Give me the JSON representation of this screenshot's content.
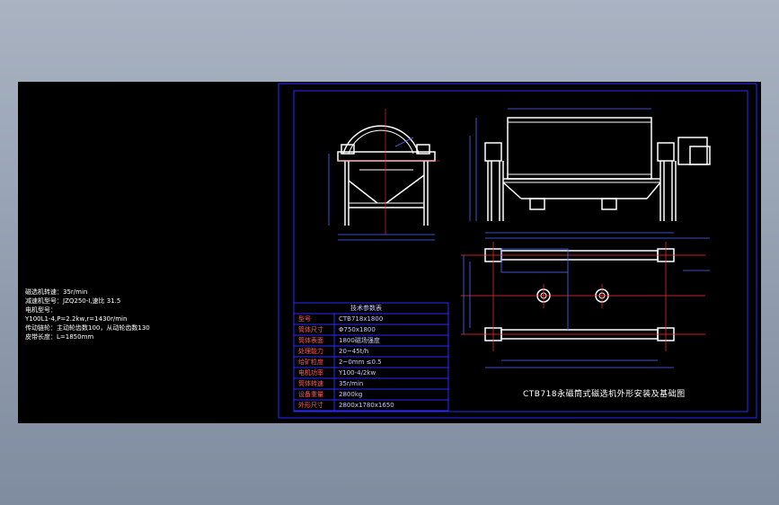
{
  "notes": [
    "磁选机转速：35r/min",
    "减速机型号：JZQ250-I,速比 31.5",
    "电机型号：",
    "Y100L1-4,P=2.2kw,r=1430r/min",
    "传动链轮：主动轮齿数100，从动轮齿数130",
    "皮带长度：L=1850mm"
  ],
  "spec_table": {
    "header": "技术参数表",
    "rows": [
      {
        "label": "型号",
        "value": "CTB718x1800"
      },
      {
        "label": "筒体尺寸",
        "value": "Φ750x1800"
      },
      {
        "label": "筒体表面",
        "value": "1800磁场强度"
      },
      {
        "label": "处理能力",
        "value": "20~45t/h"
      },
      {
        "label": "给矿粒度",
        "value": "2~0mm ≤0.5"
      },
      {
        "label": "电机功率",
        "value": "Y100-4/2kw"
      },
      {
        "label": "筒体转速",
        "value": "35r/min"
      },
      {
        "label": "设备重量",
        "value": "2800kg"
      },
      {
        "label": "外形尺寸",
        "value": "2800x1780x1650"
      }
    ]
  },
  "drawing_title": "CTB718永磁筒式磁选机外形安装及基础图",
  "colors": {
    "background": "#000000",
    "frame": "#2a2aff",
    "lines": "#ffffff",
    "dims": "#4f6bff",
    "centerline": "#ff3030",
    "labels": "#ff5a5a"
  }
}
